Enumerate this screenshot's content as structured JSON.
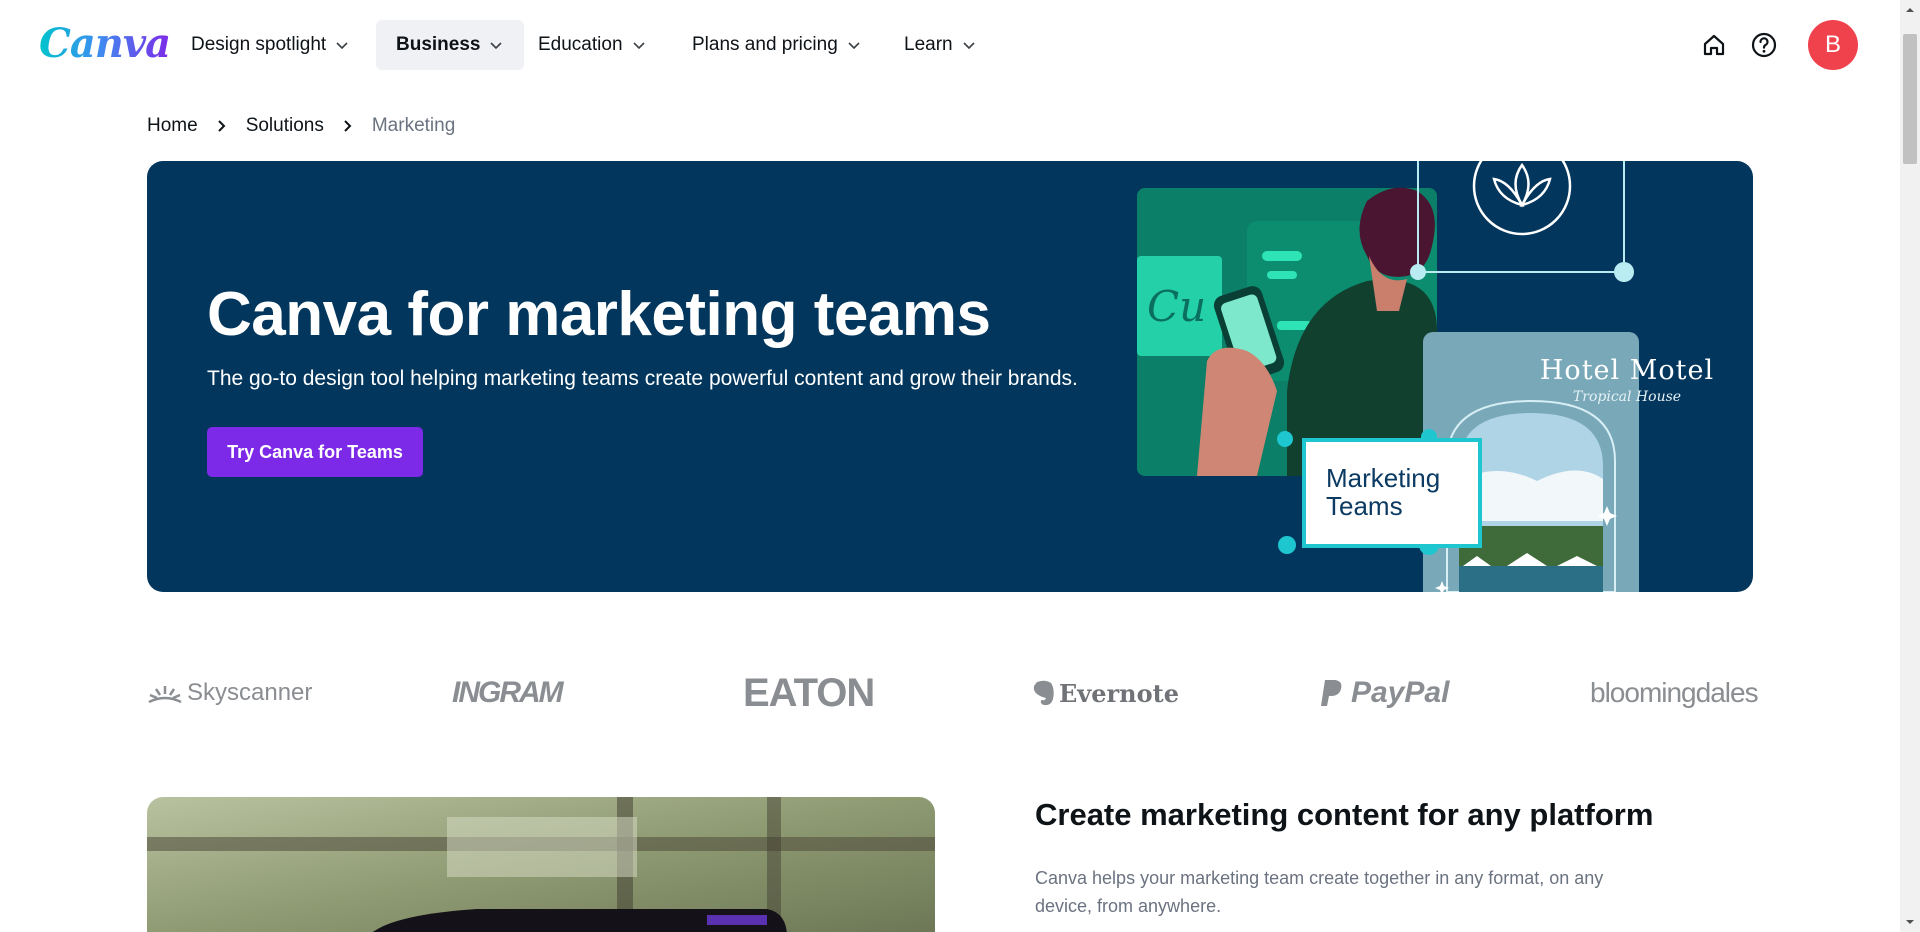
{
  "brand": {
    "logo_text": "Canva",
    "accent": "#7d2ae8",
    "hero_bg": "#02365c",
    "avatar_bg": "#f0424d"
  },
  "nav": {
    "items": [
      {
        "label": "Design spotlight"
      },
      {
        "label": "Business",
        "active": true
      },
      {
        "label": "Education"
      },
      {
        "label": "Plans and pricing"
      },
      {
        "label": "Learn"
      }
    ],
    "icons": [
      "home-icon",
      "help-icon"
    ],
    "avatar_initial": "B"
  },
  "breadcrumb": {
    "home": "Home",
    "solutions": "Solutions",
    "current": "Marketing"
  },
  "hero": {
    "title": "Canva for marketing teams",
    "subtitle": "The go-to design tool helping marketing teams create powerful content and grow their brands.",
    "cta": "Try Canva for Teams",
    "card_line1": "Marketing",
    "card_line2": "Teams",
    "hotel_title": "Hotel Motel",
    "hotel_sub": "Tropical House"
  },
  "logos": [
    "Skyscanner",
    "INGRAM",
    "EATON",
    "Evernote",
    "PayPal",
    "bloomingdales"
  ],
  "feature": {
    "title": "Create marketing content for any platform",
    "description": "Canva helps your marketing team create together in any format, on any device, from anywhere."
  }
}
